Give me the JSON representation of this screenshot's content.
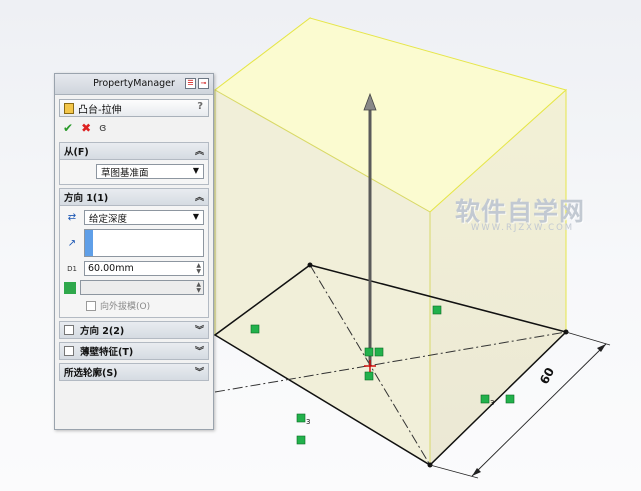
{
  "panel": {
    "title": "PropertyManager",
    "feature_name": "凸台-拉伸",
    "help": "?",
    "actions": {
      "ok_icon": "checkmark-icon",
      "cancel_icon": "cancel-x-icon",
      "preview_icon": "glasses-icon"
    },
    "from": {
      "header": "从(F)",
      "value": "草图基准面"
    },
    "direction1": {
      "header": "方向 1(1)",
      "end_condition": "给定深度",
      "depth": "60.00mm",
      "depth_icon_label": "D1",
      "draft_label": "向外拔模(O)"
    },
    "direction2": {
      "header": "方向 2(2)"
    },
    "thin": {
      "header": "薄壁特征(T)"
    },
    "contours": {
      "header": "所选轮廓(S)"
    }
  },
  "viewport": {
    "dimension": "60",
    "relation_marker": "3",
    "watermark": "软件自学网",
    "watermark_url": "WWW.RJZXW.COM"
  },
  "colors": {
    "preview_face": "#f6f3c8",
    "preview_edge": "#e8e84a",
    "relation_icon": "#22b14c"
  }
}
